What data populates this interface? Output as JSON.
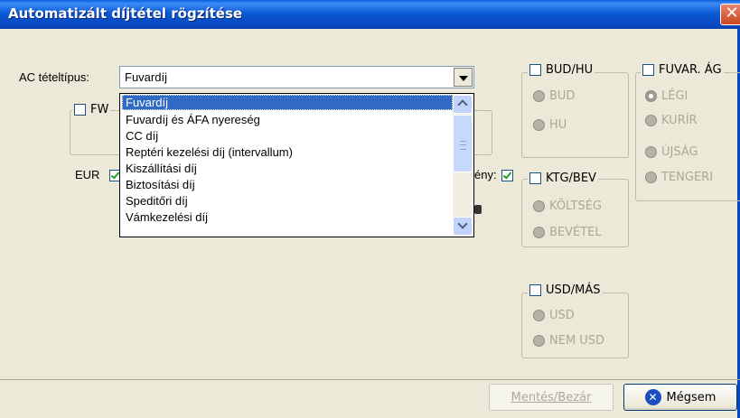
{
  "window": {
    "title": "Automatizált díjtétel rögzítése",
    "close_glyph": "✕"
  },
  "form": {
    "ac_label": "AC tételtípus:",
    "ac_value": "Fuvardíj",
    "fw_label": "FW",
    "eur_label": "EUR",
    "eny_label": "ény:"
  },
  "dropdown": {
    "options": [
      "Fuvardíj",
      "Fuvardíj és ÁFA nyereség",
      "CC díj",
      "Reptéri kezelési díj (intervallum)",
      "Kiszállítási díj",
      "Biztosítási díj",
      "Speditőri díj",
      "Vámkezelési díj"
    ],
    "selected_index": 0
  },
  "groups": {
    "bud_hu": {
      "title": "BUD/HU",
      "options": [
        "BUD",
        "HU"
      ]
    },
    "fuvar_ag": {
      "title": "FUVAR. ÁG",
      "options": [
        "LÉGI",
        "KURÍR",
        "ÚJSÁG",
        "TENGERI"
      ]
    },
    "ktg_bev": {
      "title": "KTG/BEV",
      "options": [
        "KÖLTSÉG",
        "BEVÉTEL"
      ]
    },
    "usd_mas": {
      "title": "USD/MÁS",
      "options": [
        "USD",
        "NEM USD"
      ]
    }
  },
  "buttons": {
    "save_close": "Mentés/Bezár",
    "cancel": "Mégsem",
    "cancel_icon": "✕"
  },
  "colors": {
    "titlebar": "#0a5fdb",
    "selection": "#316ac5",
    "dialog_bg": "#ece9d8"
  }
}
